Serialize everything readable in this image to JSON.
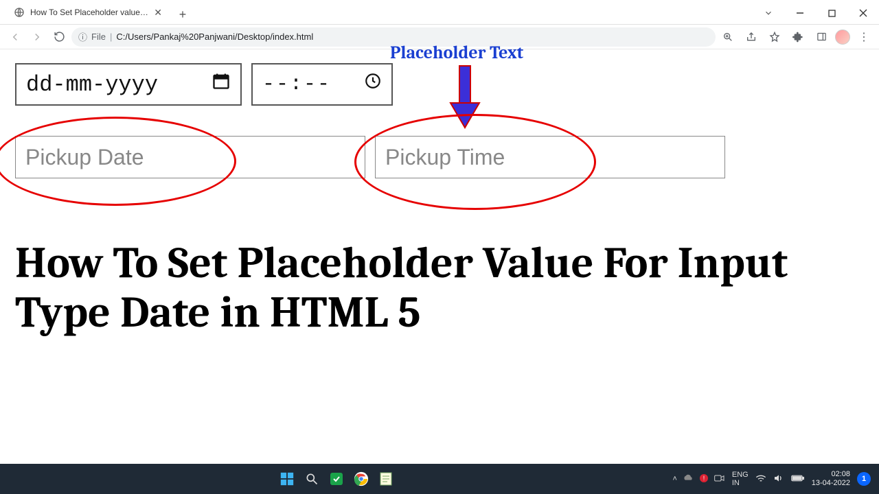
{
  "browser": {
    "tab_title": "How To Set Placeholder value for",
    "url_prefix": "File",
    "url_path": "C:/Users/Pankaj%20Panjwani/Desktop/index.html"
  },
  "page": {
    "date_native_placeholder": "dd-mm-yyyy",
    "time_native_placeholder": "--:--",
    "pickup_date_placeholder": "Pickup Date",
    "pickup_time_placeholder": "Pickup Time",
    "annotation_label": "Placeholder Text",
    "headline": "How To Set Placeholder Value For Input Type Date in HTML 5"
  },
  "taskbar": {
    "lang1": "ENG",
    "lang2": "IN",
    "time": "02:08",
    "date": "13-04-2022",
    "notif_count": "1"
  }
}
